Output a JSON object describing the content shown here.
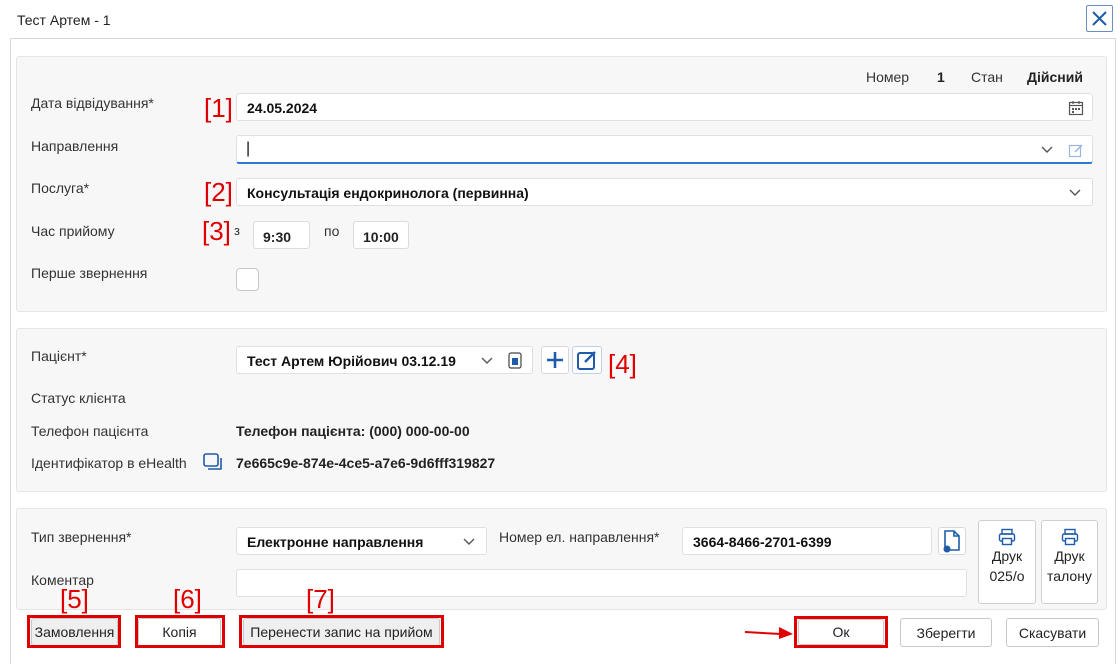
{
  "window": {
    "title": "Тест Артем - 1"
  },
  "header": {
    "number_label": "Номер",
    "number_value": "1",
    "state_label": "Стан",
    "state_value": "Дійсний"
  },
  "visit": {
    "date_label": "Дата відвідування*",
    "date_value": "24.05.2024",
    "referral_label": "Направлення",
    "referral_value": "|",
    "service_label": "Послуга*",
    "service_value": "Консультація ендокринолога (первинна)",
    "time_label": "Час прийому",
    "time_from_label": "з",
    "time_from": "9:30",
    "time_to_label": "по",
    "time_to": "10:00",
    "first_visit_label": "Перше звернення"
  },
  "patient": {
    "patient_label": "Пацієнт*",
    "patient_value": "Тест Артем Юрійович 03.12.19",
    "status_label": "Статус клієнта",
    "phone_label": "Телефон пацієнта",
    "phone_value": "Телефон пацієнта: (000) 000-00-00",
    "ehealth_label": "Ідентифікатор в eHealth",
    "ehealth_value": "7e665c9e-874e-4ce5-a7e6-9d6fff319827"
  },
  "appeal": {
    "type_label": "Тип звернення*",
    "type_value": "Електронне направлення",
    "referral_number_label": "Номер ел. направлення*",
    "referral_number_value": "3664-8466-2701-6399",
    "comment_label": "Коментар",
    "print_025_line1": "Друк",
    "print_025_line2": "025/о",
    "print_ticket_line1": "Друк",
    "print_ticket_line2": "талону"
  },
  "footer": {
    "order_label": "Замовлення",
    "copy_label": "Копія",
    "move_label": "Перенести запис на прийом",
    "ok_label": "Ок",
    "save_label": "Зберегти",
    "cancel_label": "Скасувати"
  },
  "annotations": [
    "[1]",
    "[2]",
    "[3]",
    "[4]",
    "[5]",
    "[6]",
    "[7]"
  ],
  "colors": {
    "accent": "#2a78d6",
    "annotation": "#e00000"
  },
  "icons": [
    "close-icon",
    "calendar-icon",
    "chevron-down-icon",
    "edit-icon",
    "card-icon",
    "plus-icon",
    "copy-icon",
    "document-icon",
    "printer-icon",
    "arrow-right-icon"
  ]
}
